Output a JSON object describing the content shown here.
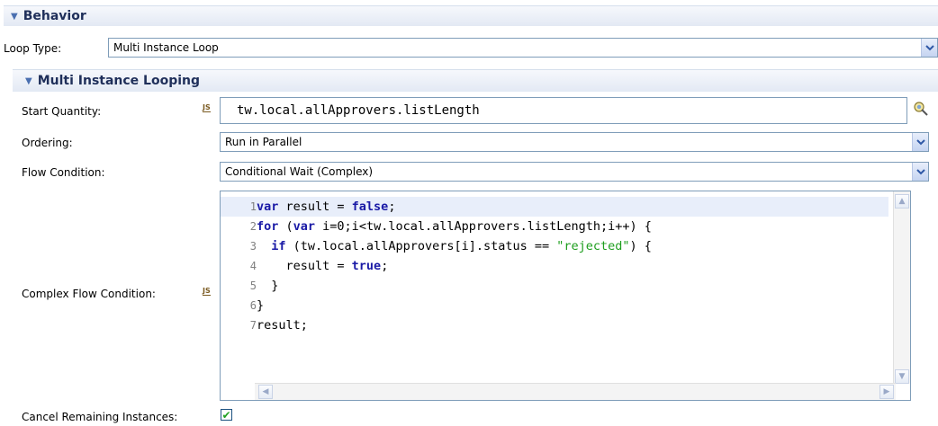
{
  "behavior": {
    "section_title": "Behavior",
    "loop_type_label": "Loop Type:",
    "loop_type_value": "Multi Instance Loop"
  },
  "multi_instance": {
    "section_title": "Multi Instance Looping",
    "start_quantity_label": "Start Quantity:",
    "start_quantity_value": "tw.local.allApprovers.listLength",
    "ordering_label": "Ordering:",
    "ordering_value": "Run in Parallel",
    "flow_condition_label": "Flow Condition:",
    "flow_condition_value": "Conditional Wait (Complex)",
    "complex_flow_label": "Complex Flow Condition:",
    "cancel_remaining_label": "Cancel Remaining Instances:",
    "cancel_remaining_checked": true
  },
  "js_icon_text": "JS",
  "code": {
    "lines": [
      {
        "n": "1",
        "text": "var result = false;"
      },
      {
        "n": "2",
        "text": "for (var i=0;i<tw.local.allApprovers.listLength;i++) {"
      },
      {
        "n": "3",
        "text": "  if (tw.local.allApprovers[i].status == \"rejected\") {"
      },
      {
        "n": "4",
        "text": "    result = true;"
      },
      {
        "n": "5",
        "text": "  }"
      },
      {
        "n": "6",
        "text": "}"
      },
      {
        "n": "7",
        "text": "result;"
      }
    ]
  },
  "icons": {
    "expand": "triangle-down-icon",
    "dropdown": "chevron-down-icon",
    "variable_picker": "variable-picker-icon",
    "js": "javascript-icon",
    "check": "checkmark-icon"
  },
  "colors": {
    "keyword": "#1a1aa6",
    "string": "#1e9e1e",
    "header_text": "#1f2f5a",
    "highlight_line": "#e8eefa"
  }
}
